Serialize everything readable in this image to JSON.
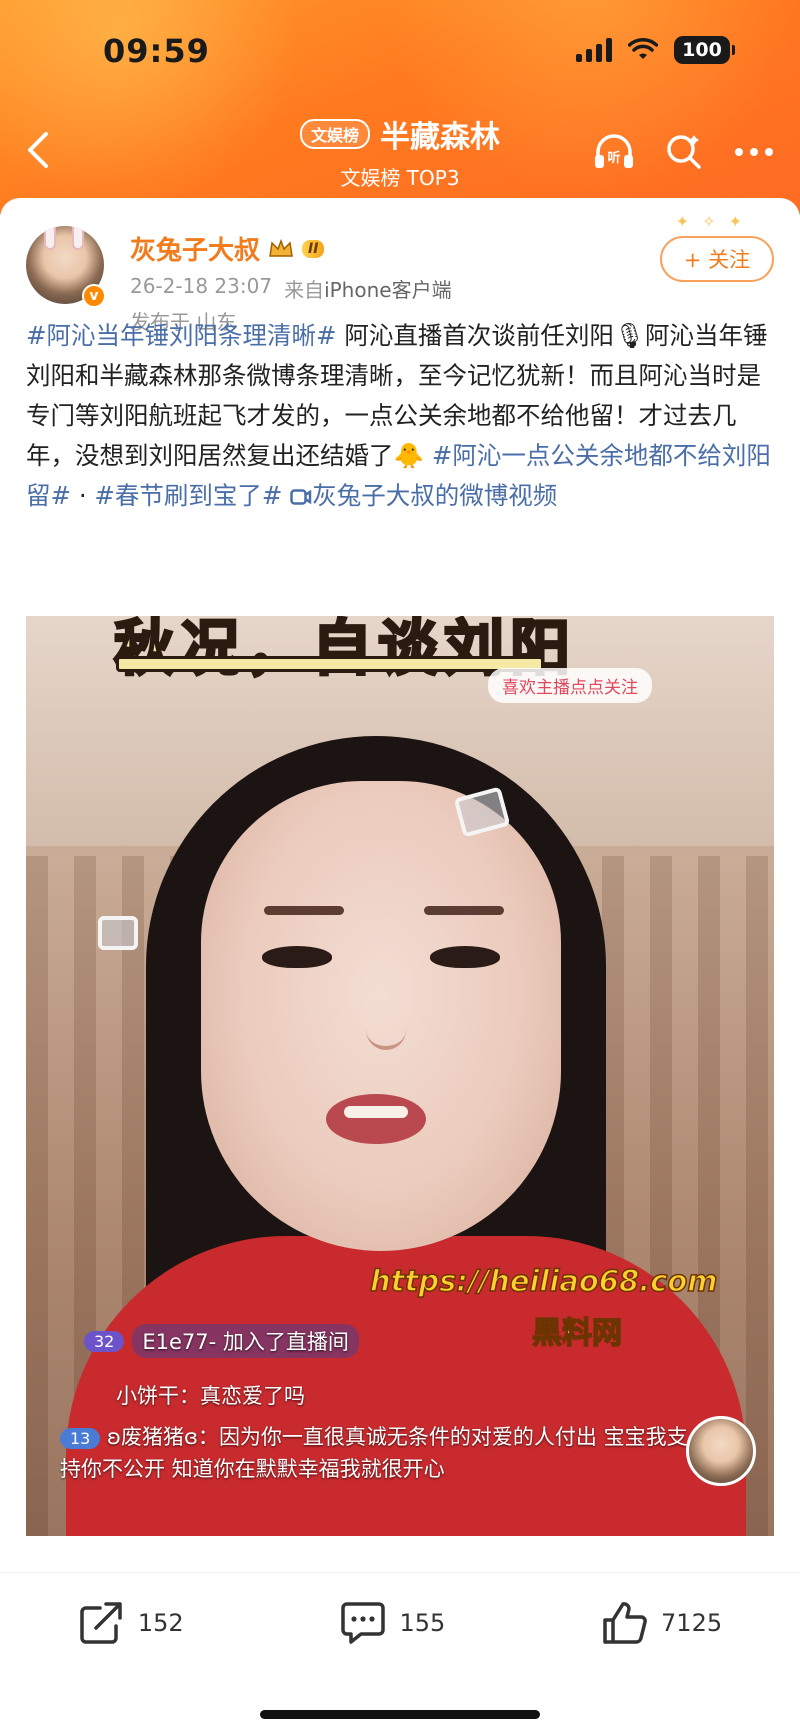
{
  "status_bar": {
    "time": "09:59",
    "battery": "100"
  },
  "nav": {
    "badge": "文娱榜",
    "title": "半藏森林",
    "subtitle": "文娱榜 TOP3"
  },
  "post": {
    "username": "灰兔子大叔",
    "level": "II",
    "timestamp": "26-2-18 23:07",
    "source_prefix": "来自",
    "source": "iPhone客户端",
    "location": "发布于 山东",
    "follow_label": "+ 关注",
    "text": {
      "tag1": "#阿沁当年锤刘阳条理清晰#",
      "body1": " 阿沁直播首次谈前任刘阳",
      "emoji1": "🎙",
      "body2": "阿沁当年锤刘阳和半藏森林那条微博条理清晰，至今记忆犹新！而且阿沁当时是专门等刘阳航班起飞才发的，一点公关余地都不给他留！才过去几年，没想到刘阳居然复出还结婚了",
      "emoji2": "🐥",
      "tag2": "#阿沁一点公关余地都不给刘阳留#",
      "sep": " · ",
      "tag3": "#春节刷到宝了#",
      "video_link": "灰兔子大叔的微博视频"
    }
  },
  "video": {
    "caption_top": "秋况，自谈刘阳",
    "follow_pill": "喜欢主播点点关注",
    "watermark_url": "https://heiliao68.com",
    "watermark_name": "黑料网",
    "chat": {
      "join_level": "32",
      "join_text": "E1e77- 加入了直播间",
      "line2": "小饼干：真恋爱了吗",
      "line3_level": "13",
      "line3_user": "ʚ废猪猪ɞ：",
      "line3_text": "因为你一直很真诚无条件的对爱的人付出 宝宝我支持你不公开 知道你在默默幸福我就很开心"
    }
  },
  "actions": {
    "share": "152",
    "comment": "155",
    "like": "7125"
  },
  "colors": {
    "header_orange": "#ff7a1f",
    "username_orange": "#f07c1e",
    "topic_blue": "#4a6ea8"
  }
}
